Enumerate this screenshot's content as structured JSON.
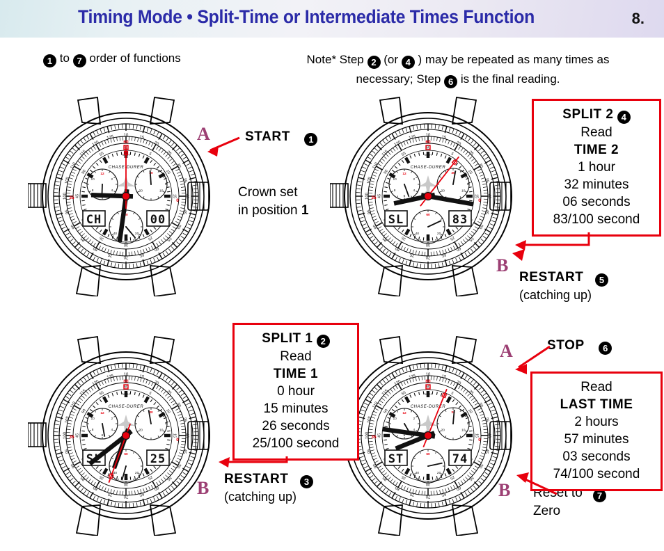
{
  "header": {
    "title": "Timing Mode • Split-Time or Intermediate Times Function",
    "page_number": "8.",
    "title_color": "#2b2ba8"
  },
  "legend": {
    "order_prefix": "",
    "from_step": "1",
    "to_word": "to",
    "to_step": "7",
    "order_text": "order of functions",
    "note_line1_a": "Note* Step",
    "note_step_a": "2",
    "note_line1_b": "(or",
    "note_step_b": "4",
    "note_line1_c": ") may be repeated as many times",
    "note_line2_a": "as necessary; Step",
    "note_step_c": "6",
    "note_line2_b": "is the final reading."
  },
  "colors": {
    "accent_red": "#e8000d",
    "pusher_purple": "#9c3f73",
    "brand_blue": "#2b2ba8"
  },
  "watches": [
    {
      "id": "watch-start",
      "brand": "CHASE-DURER",
      "digital_left": "CH",
      "digital_right": "00",
      "chrono_seconds_deg": 0,
      "hour_deg": 272,
      "minute_deg": 188,
      "subdial_small_hand_deg": 182,
      "subdial_right_hand_deg": 356,
      "subdial_bottom_hand_deg": 140
    },
    {
      "id": "watch-split2",
      "brand": "CHASE-DURER",
      "digital_left": "SL",
      "digital_right": "83",
      "chrono_seconds_deg": 38,
      "hour_deg": 258,
      "minute_deg": 100,
      "subdial_small_hand_deg": 160,
      "subdial_right_hand_deg": 10,
      "subdial_bottom_hand_deg": 65
    },
    {
      "id": "watch-split1",
      "brand": "CHASE-DURER",
      "digital_left": "SL",
      "digital_right": "25",
      "chrono_seconds_deg": 200,
      "hour_deg": 200,
      "minute_deg": 232,
      "subdial_small_hand_deg": 170,
      "subdial_right_hand_deg": 350,
      "subdial_bottom_hand_deg": 196
    },
    {
      "id": "watch-stop",
      "brand": "CHASE-DURER",
      "digital_left": "ST",
      "digital_right": "74",
      "chrono_seconds_deg": 22,
      "hour_deg": 248,
      "minute_deg": 278,
      "subdial_small_hand_deg": 150,
      "subdial_right_hand_deg": 5,
      "subdial_bottom_hand_deg": 78
    }
  ],
  "callouts": {
    "start": {
      "label": "START",
      "step": "1"
    },
    "crown_note_line1": "Crown set",
    "crown_note_line2a": "in position",
    "crown_note_line2b": "1",
    "restart5": {
      "label": "RESTART",
      "step": "5",
      "sub": "(catching up)"
    },
    "restart3": {
      "label": "RESTART",
      "step": "3",
      "sub": "(catching up)"
    },
    "stop": {
      "label": "STOP",
      "step": "6"
    },
    "reset": {
      "line1": "Reset to",
      "step": "7",
      "line2": "Zero"
    },
    "pusher_a_top": "A",
    "pusher_b_top": "B",
    "pusher_a_bottom": "A",
    "pusher_b_bottom_left": "B",
    "pusher_b_bottom_right": "B"
  },
  "boxes": {
    "split2": {
      "header": "SPLIT 2",
      "step": "4",
      "read": "Read",
      "time_label": "TIME 2",
      "hours": "1 hour",
      "minutes": "32 minutes",
      "seconds": "06 seconds",
      "hundredths": "83/100 second"
    },
    "split1": {
      "header": "SPLIT 1",
      "step": "2",
      "read": "Read",
      "time_label": "TIME 1",
      "hours": "0 hour",
      "minutes": "15 minutes",
      "seconds": "26 seconds",
      "hundredths": "25/100 second"
    },
    "last": {
      "read": "Read",
      "time_label": "LAST TIME",
      "hours": "2 hours",
      "minutes": "57 minutes",
      "seconds": "03 seconds",
      "hundredths": "74/100 second"
    }
  }
}
